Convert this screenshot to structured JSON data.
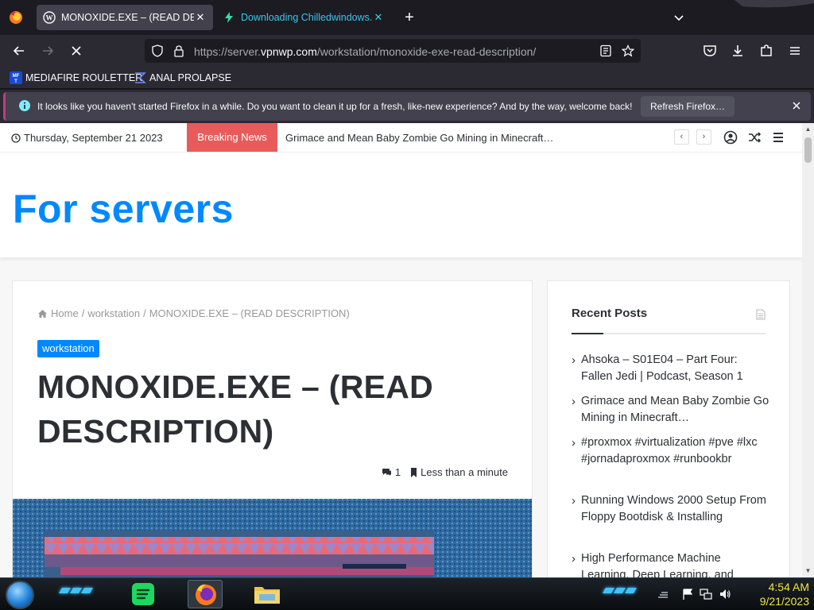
{
  "browser": {
    "tabs": [
      {
        "title": "MONOXIDE.EXE – (READ DESCRIPTION)",
        "active": true,
        "favicon": "wordpress-icon"
      },
      {
        "title": "Downloading Chilledwindows.e",
        "active": false,
        "favicon": "lightning-icon"
      }
    ],
    "url_prefix": "https://server.",
    "url_domain": "vpnwp.com",
    "url_path": "/workstation/monoxide-exe-read-description/",
    "bookmarks": [
      {
        "label": "MEDIAFIRE ROULETTER",
        "icon": "mft-icon"
      },
      {
        "label": "ANAL PROLAPSE",
        "icon": "bookmark-glyph-icon"
      }
    ],
    "notification": {
      "message": "It looks like you haven't started Firefox in a while. Do you want to clean it up for a fresh, like-new experience? And by the way, welcome back!",
      "button": "Refresh Firefox…"
    }
  },
  "site": {
    "date": "Thursday, September 21 2023",
    "breaking_label": "Breaking News",
    "ticker": "Grimace and Mean Baby Zombie Go Mining in Minecraft…",
    "logo": "For servers",
    "accent": "#0088ff",
    "breaking_color": "#e85b5b"
  },
  "post": {
    "breadcrumb": {
      "home": "Home",
      "sep": "/",
      "category": "workstation",
      "current": "MONOXIDE.EXE – (READ DESCRIPTION)"
    },
    "category_badge": "workstation",
    "title": "MONOXIDE.EXE – (READ DESCRIPTION)",
    "comments": "1",
    "read_time": "Less than a minute"
  },
  "sidebar": {
    "widget_title": "Recent Posts",
    "posts": [
      "Ahsoka – S01E04 – Part Four: Fallen Jedi | Podcast, Season 1",
      "Grimace and Mean Baby Zombie Go Mining in Minecraft…",
      "#proxmox #virtualization #pve #lxc #jornadaproxmox #runbookbr",
      "Running Windows 2000 Setup From Floppy Bootdisk & Installing",
      "High Performance Machine Learning, Deep Learning, and"
    ]
  },
  "taskbar": {
    "time": "4:54 AM",
    "date": "9/21/2023",
    "apps": [
      "spotify-icon",
      "firefox-icon",
      "file-explorer-icon"
    ]
  }
}
